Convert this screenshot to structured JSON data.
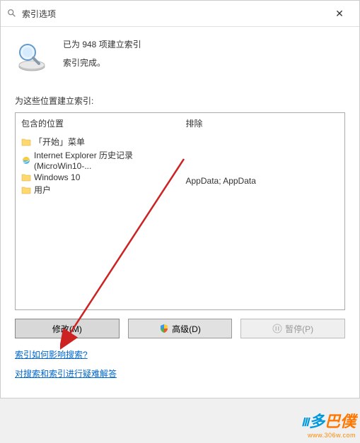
{
  "titlebar": {
    "title": "索引选项",
    "close_label": "✕"
  },
  "status": {
    "line1": "已为 948 项建立索引",
    "line2": "索引完成。"
  },
  "section_label": "为这些位置建立索引:",
  "columns": {
    "included_header": "包含的位置",
    "excluded_header": "排除"
  },
  "locations": [
    {
      "icon": "folder",
      "label": "「开始」菜单"
    },
    {
      "icon": "ie",
      "label": "Internet Explorer 历史记录 (MicroWin10-..."
    },
    {
      "icon": "folder",
      "label": "Windows 10"
    },
    {
      "icon": "folder",
      "label": "用户"
    }
  ],
  "excluded_text": "AppData; AppData",
  "buttons": {
    "modify": "修改(M)",
    "advanced": "高级(D)",
    "pause": "暂停(P)"
  },
  "links": {
    "how_affects": "索引如何影响搜索?",
    "troubleshoot": "对搜索和索引进行疑难解答"
  },
  "watermark": {
    "text_blue": "多",
    "text_orange": "巴僕",
    "url": "www.306w.com"
  }
}
